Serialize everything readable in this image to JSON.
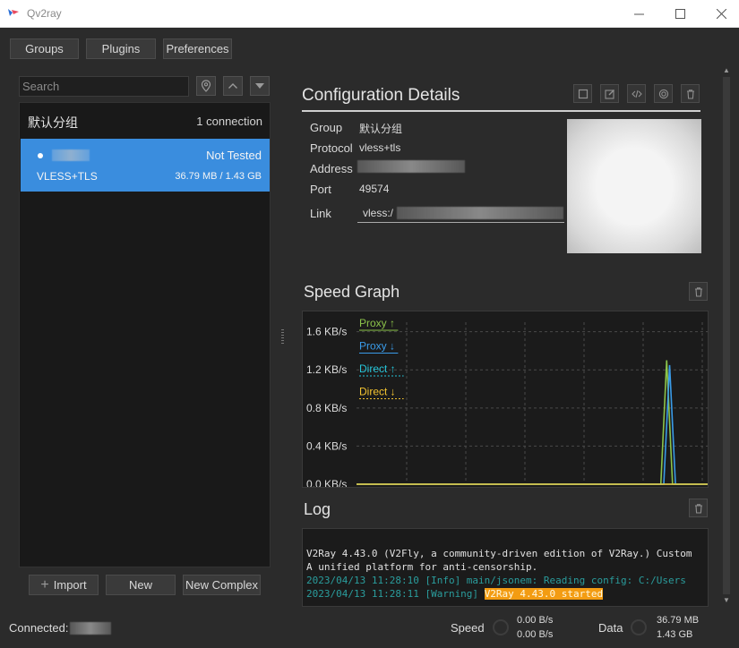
{
  "window": {
    "title": "Qv2ray"
  },
  "toolbar": {
    "groups_label": "Groups",
    "plugins_label": "Plugins",
    "preferences_label": "Preferences"
  },
  "search": {
    "placeholder": "Search"
  },
  "connection_list": {
    "group_name": "默认分组",
    "group_count": "1 connection",
    "items": [
      {
        "status": "Not Tested",
        "protocol": "VLESS+TLS",
        "data_usage": "36.79 MB / 1.43 GB"
      }
    ]
  },
  "bottom_buttons": {
    "import_label": "Import",
    "new_label": "New",
    "new_complex_label": "New Complex"
  },
  "config_details": {
    "title": "Configuration Details",
    "group_label": "Group",
    "group_value": "默认分组",
    "protocol_label": "Protocol",
    "protocol_value": "vless+tls",
    "address_label": "Address",
    "port_label": "Port",
    "port_value": "49574",
    "link_label": "Link",
    "link_value": "vless:/"
  },
  "speed_graph": {
    "title": "Speed Graph",
    "legend": [
      {
        "label": "Proxy ↑",
        "color": "#8bc34a"
      },
      {
        "label": "Proxy ↓",
        "color": "#3a9be8"
      },
      {
        "label": "Direct ↑",
        "color": "#26c6da"
      },
      {
        "label": "Direct ↓",
        "color": "#f4c430"
      }
    ]
  },
  "chart_data": {
    "type": "line",
    "yticks": [
      "1.6 KB/s",
      "1.2 KB/s",
      "0.8 KB/s",
      "0.4 KB/s",
      "0.0 KB/s"
    ],
    "ylim": [
      0,
      1.7
    ],
    "xlim": [
      0,
      60
    ],
    "grid": true,
    "legend_position": "top-left",
    "series": [
      {
        "name": "Proxy ↑",
        "color": "#8bc34a",
        "x": [
          0,
          52,
          53,
          54,
          55,
          60
        ],
        "y": [
          0,
          0,
          1.3,
          0,
          0,
          0
        ]
      },
      {
        "name": "Proxy ↓",
        "color": "#3a9be8",
        "x": [
          0,
          52.5,
          53.5,
          54.5,
          60
        ],
        "y": [
          0,
          0,
          1.25,
          0,
          0
        ]
      },
      {
        "name": "Direct ↑",
        "color": "#26c6da",
        "x": [
          0,
          60
        ],
        "y": [
          0,
          0
        ]
      },
      {
        "name": "Direct ↓",
        "color": "#f4c430",
        "x": [
          0,
          60
        ],
        "y": [
          0,
          0
        ]
      }
    ]
  },
  "log": {
    "title": "Log",
    "lines": [
      {
        "text": "V2Ray 4.43.0 (V2Fly, a community-driven edition of V2Ray.) Custom",
        "color": "#e0e0e0"
      },
      {
        "text": "A unified platform for anti-censorship.",
        "color": "#e0e0e0"
      },
      {
        "text": "2023/04/13 11:28:10 [Info] main/jsonem: Reading config: C:/Users",
        "color": "#2a9d9d"
      },
      {
        "prefix": "2023/04/13 11:28:11 [Warning] ",
        "highlight": "V2Ray 4.43.0 started",
        "color": "#2a9d9d"
      }
    ]
  },
  "statusbar": {
    "connected_label": "Connected:",
    "speed_label": "Speed",
    "speed_up": "0.00 B/s",
    "speed_down": "0.00 B/s",
    "data_label": "Data",
    "data_up": "36.79 MB",
    "data_down": "1.43 GB"
  }
}
